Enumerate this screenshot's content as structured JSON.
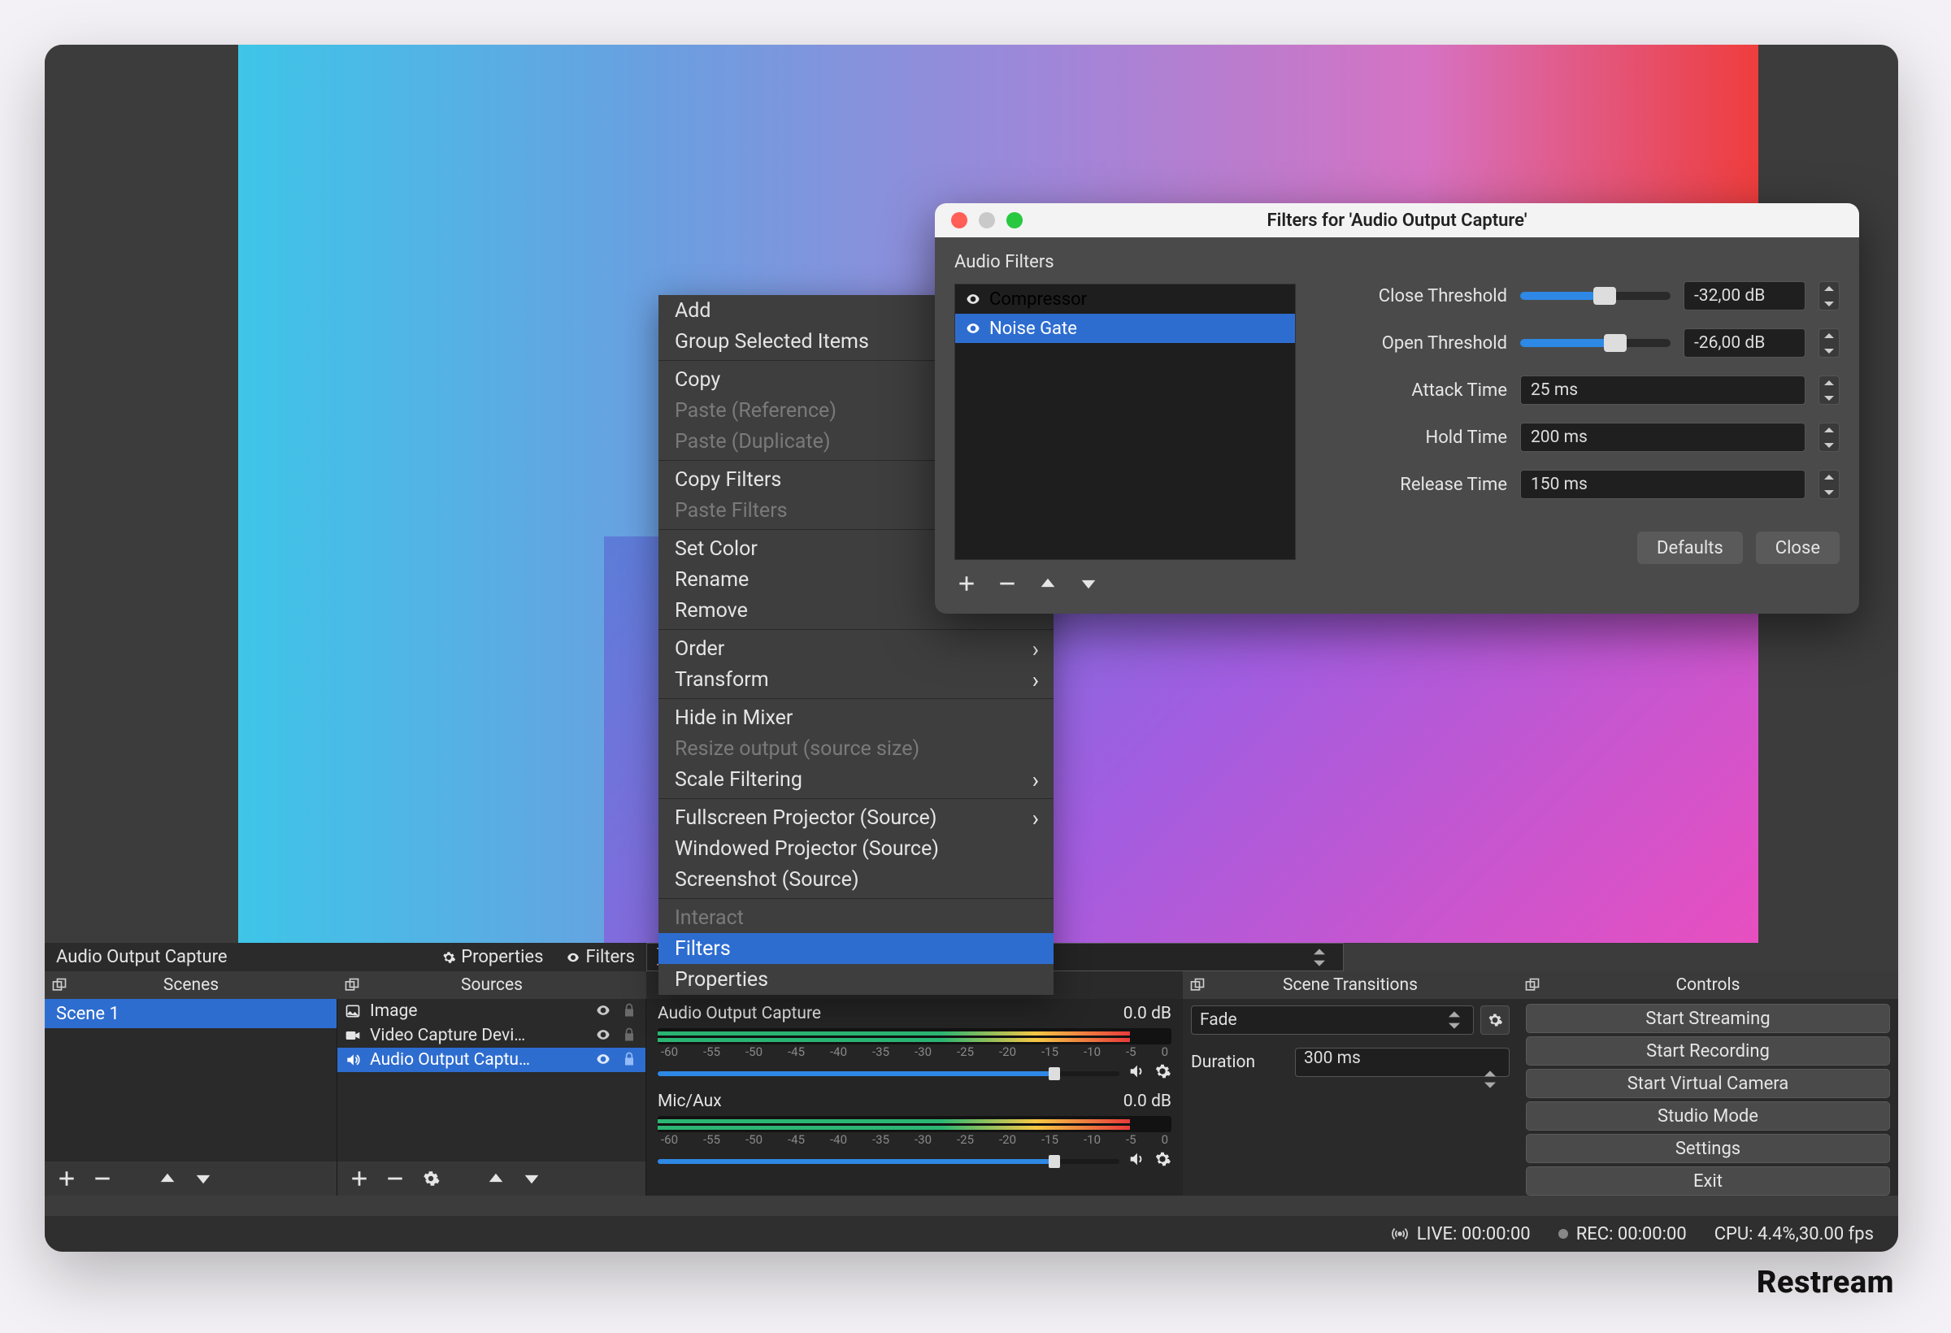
{
  "watermark": "Restream",
  "props_bar": {
    "label": "Audio Output Capture",
    "properties_btn": "Properties",
    "filters_btn": "Filters"
  },
  "panels": {
    "scenes_header": "Scenes",
    "sources_header": "Sources",
    "scene_trans_header": "Scene Transitions",
    "controls_header": "Controls"
  },
  "scenes": {
    "items": [
      "Scene 1"
    ]
  },
  "sources": {
    "rows": [
      {
        "name": "Image",
        "icon": "image"
      },
      {
        "name": "Video Capture Devi…",
        "icon": "camera"
      },
      {
        "name": "Audio Output Captu…",
        "icon": "speaker",
        "selected": true
      }
    ]
  },
  "mixer": {
    "ch1": {
      "name": "Audio Output Capture",
      "level": "0.0 dB"
    },
    "ch2": {
      "name": "Mic/Aux",
      "level": "0.0 dB"
    },
    "ticks": [
      "-60",
      "-55",
      "-50",
      "-45",
      "-40",
      "-35",
      "-30",
      "-25",
      "-20",
      "-15",
      "-10",
      "-5",
      "0"
    ]
  },
  "transitions": {
    "type": "Fade",
    "duration_label": "Duration",
    "duration_value": "300 ms"
  },
  "controls": {
    "buttons": [
      "Start Streaming",
      "Start Recording",
      "Start Virtual Camera",
      "Studio Mode",
      "Settings",
      "Exit"
    ]
  },
  "status": {
    "live": "LIVE: 00:00:00",
    "rec": "REC: 00:00:00",
    "cpu": "CPU: 4.4%,30.00 fps"
  },
  "context_menu": {
    "items": [
      {
        "label": "Add"
      },
      {
        "label": "Group Selected Items"
      },
      {
        "sep": true
      },
      {
        "label": "Copy"
      },
      {
        "label": "Paste (Reference)",
        "disabled": true
      },
      {
        "label": "Paste (Duplicate)",
        "disabled": true
      },
      {
        "sep": true
      },
      {
        "label": "Copy Filters"
      },
      {
        "label": "Paste Filters",
        "disabled": true
      },
      {
        "sep": true
      },
      {
        "label": "Set Color"
      },
      {
        "label": "Rename"
      },
      {
        "label": "Remove"
      },
      {
        "sep": true
      },
      {
        "label": "Order",
        "sub": true
      },
      {
        "label": "Transform",
        "sub": true
      },
      {
        "sep": true
      },
      {
        "label": "Hide in Mixer"
      },
      {
        "label": "Resize output (source size)",
        "disabled": true
      },
      {
        "label": "Scale Filtering",
        "sub": true
      },
      {
        "sep": true
      },
      {
        "label": "Fullscreen Projector (Source)",
        "sub": true
      },
      {
        "label": "Windowed Projector (Source)"
      },
      {
        "label": "Screenshot (Source)"
      },
      {
        "sep": true
      },
      {
        "label": "Interact",
        "disabled": true
      },
      {
        "label": "Filters",
        "highlight": true
      },
      {
        "label": "Properties"
      }
    ]
  },
  "filters_dialog": {
    "title": "Filters for 'Audio Output Capture'",
    "section_label": "Audio Filters",
    "filters": [
      {
        "name": "Compressor"
      },
      {
        "name": "Noise Gate",
        "selected": true
      }
    ],
    "params": {
      "close_threshold": {
        "label": "Close Threshold",
        "value": "-32,00 dB",
        "fill": 56
      },
      "open_threshold": {
        "label": "Open Threshold",
        "value": "-26,00 dB",
        "fill": 63
      },
      "attack_time": {
        "label": "Attack Time",
        "value": "25 ms"
      },
      "hold_time": {
        "label": "Hold Time",
        "value": "200 ms"
      },
      "release_time": {
        "label": "Release Time",
        "value": "150 ms"
      }
    },
    "defaults_btn": "Defaults",
    "close_btn": "Close"
  }
}
